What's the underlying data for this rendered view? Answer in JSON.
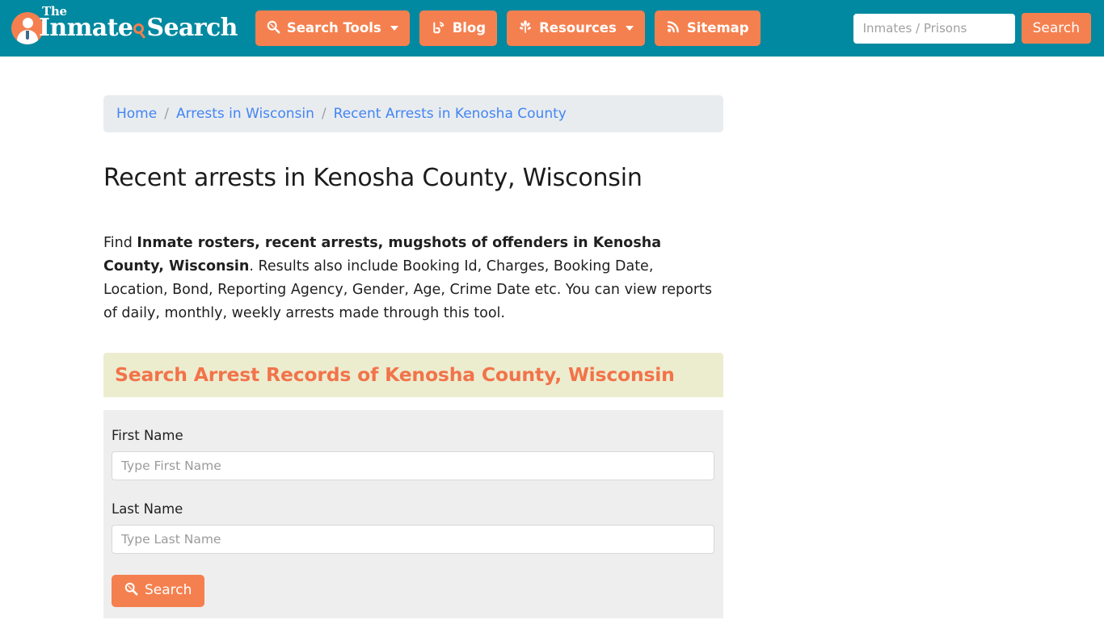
{
  "brand": {
    "the": "The",
    "word_one": "Inmate",
    "word_two": "Search",
    "logo_icon": "person-in-circle-icon",
    "glass_icon": "magnifier-icon"
  },
  "nav": {
    "items": [
      {
        "label": "Search Tools",
        "icon": "magnifier-icon",
        "has_caret": true
      },
      {
        "label": "Blog",
        "icon": "blogger-b-icon",
        "has_caret": false
      },
      {
        "label": "Resources",
        "icon": "sprout-leaf-icon",
        "has_caret": true
      },
      {
        "label": "Sitemap",
        "icon": "rss-feed-icon",
        "has_caret": false
      }
    ]
  },
  "header_search": {
    "placeholder": "Inmates / Prisons",
    "value": "",
    "button_label": "Search"
  },
  "breadcrumb": {
    "separator": "/",
    "items": [
      {
        "label": "Home"
      },
      {
        "label": "Arrests in Wisconsin"
      },
      {
        "label": "Recent Arrests in Kenosha County"
      }
    ]
  },
  "main": {
    "title": "Recent arrests in Kenosha County, Wisconsin",
    "intro": {
      "lead": "Find ",
      "bold": "Inmate rosters, recent arrests, mugshots of offenders in Kenosha County, Wisconsin",
      "rest": ". Results also include Booking Id, Charges, Booking Date, Location, Bond, Reporting Agency, Gender, Age, Crime Date etc. You can view reports of daily, monthly, weekly arrests made through this tool."
    },
    "panel_heading": "Search Arrest Records of Kenosha County, Wisconsin",
    "form": {
      "first_name_label": "First Name",
      "first_name_placeholder": "Type First Name",
      "first_name_value": "",
      "last_name_label": "Last Name",
      "last_name_placeholder": "Type Last Name",
      "last_name_value": "",
      "submit_label": "Search",
      "submit_icon": "magnifier-icon"
    }
  },
  "colors": {
    "header_teal": "#0089a0",
    "accent_orange": "#f5804f",
    "heading_orange": "#f2734a",
    "panel_cream": "#ecedcf",
    "form_gray": "#eeeeee",
    "breadcrumb_gray": "#e9ecef",
    "link_blue": "#4285f4"
  }
}
